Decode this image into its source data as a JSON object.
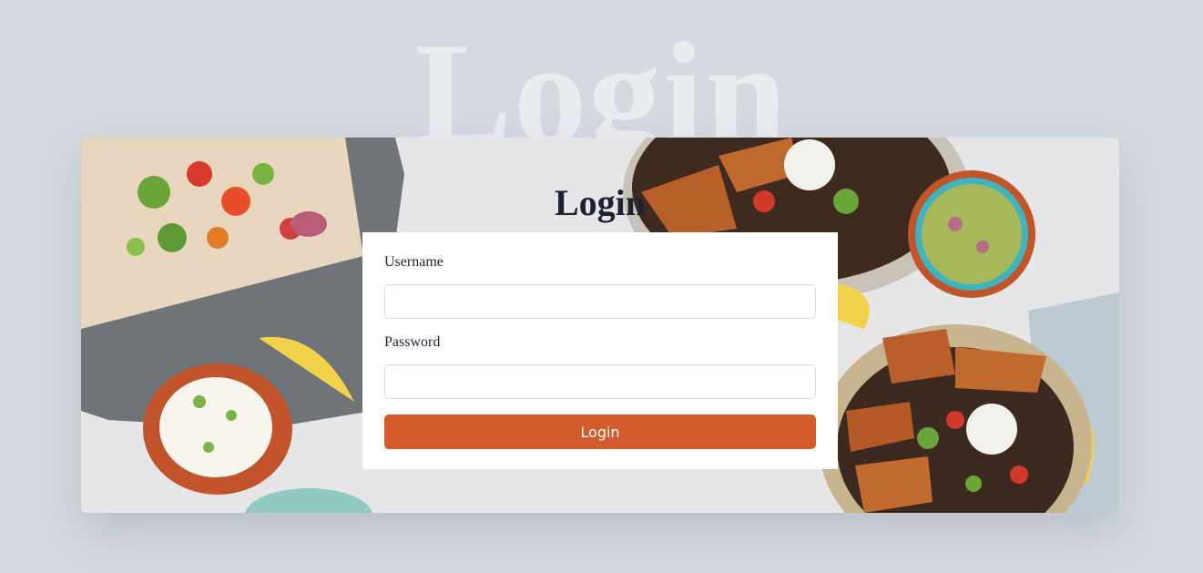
{
  "page": {
    "background_title": "Login",
    "background_color": "#d5dae1"
  },
  "hero_image": {
    "description_icon": "food-photo-icon"
  },
  "form": {
    "title": "Login",
    "username_label": "Username",
    "username_value": "",
    "password_label": "Password",
    "password_value": "",
    "submit_label": "Login",
    "accent_color": "#d25b2c"
  }
}
